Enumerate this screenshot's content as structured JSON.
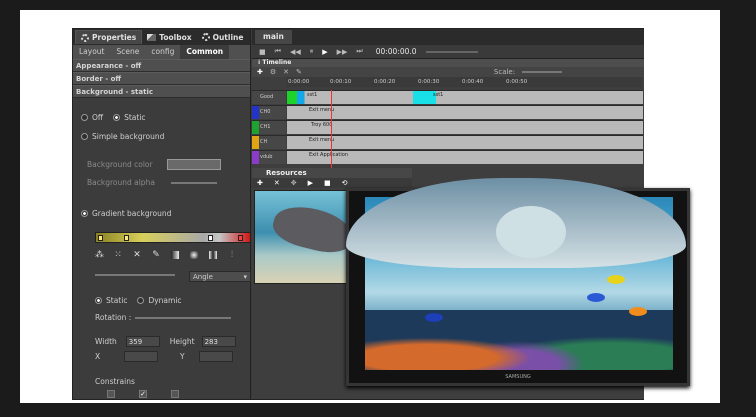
{
  "left_panel": {
    "tabs": [
      {
        "label": "Properties",
        "icon": "gear-icon"
      },
      {
        "label": "Toolbox",
        "icon": "toolbox-icon"
      },
      {
        "label": "Outline",
        "icon": "gear-icon"
      }
    ],
    "subtabs": [
      "Layout",
      "Scene",
      "config",
      "Common"
    ],
    "sections": {
      "appearance": "Appearance - off",
      "border": "Border - off",
      "background": "Background - static"
    },
    "bg_mode": {
      "off": "Off",
      "static": "Static"
    },
    "simple_background": "Simple background",
    "background_color_label": "Background color",
    "background_alpha_label": "Background alpha",
    "gradient_background": "Gradient background",
    "angle_select": "Angle",
    "static_label": "Static",
    "dynamic_label": "Dynamic",
    "rotation_label": "Rotation :",
    "width_label": "Width",
    "width_value": "359",
    "height_label": "Height",
    "height_value": "283",
    "x_label": "X",
    "y_label": "Y",
    "constrains_label": "Constrains"
  },
  "main_panel": {
    "tab": "main",
    "timecode": "00:00:00.0",
    "timeline_title": "Timeline",
    "scale_label": "Scale:",
    "ruler": [
      "0:00:00",
      "0:00:10",
      "0:00:20",
      "0:00:30",
      "0:00:40",
      "0:00:50"
    ],
    "tracks": [
      {
        "name": "Good",
        "clips": [
          "sst1",
          "sst1"
        ]
      },
      {
        "name": "CH0",
        "clips": [
          "Exit menu"
        ]
      },
      {
        "name": "CH1",
        "clips": [
          "Troy 600"
        ]
      },
      {
        "name": "CH",
        "clips": [
          "Exit menu"
        ]
      },
      {
        "name": "vdub",
        "clips": [
          "Exit Application"
        ]
      }
    ],
    "resources_title": "Resources"
  },
  "tv": {
    "brand": "SAMSUNG"
  },
  "colors": {
    "accent_green": "#3cbf3c",
    "accent_cyan": "#19e0e6",
    "gradient_end_red": "#d01818"
  }
}
